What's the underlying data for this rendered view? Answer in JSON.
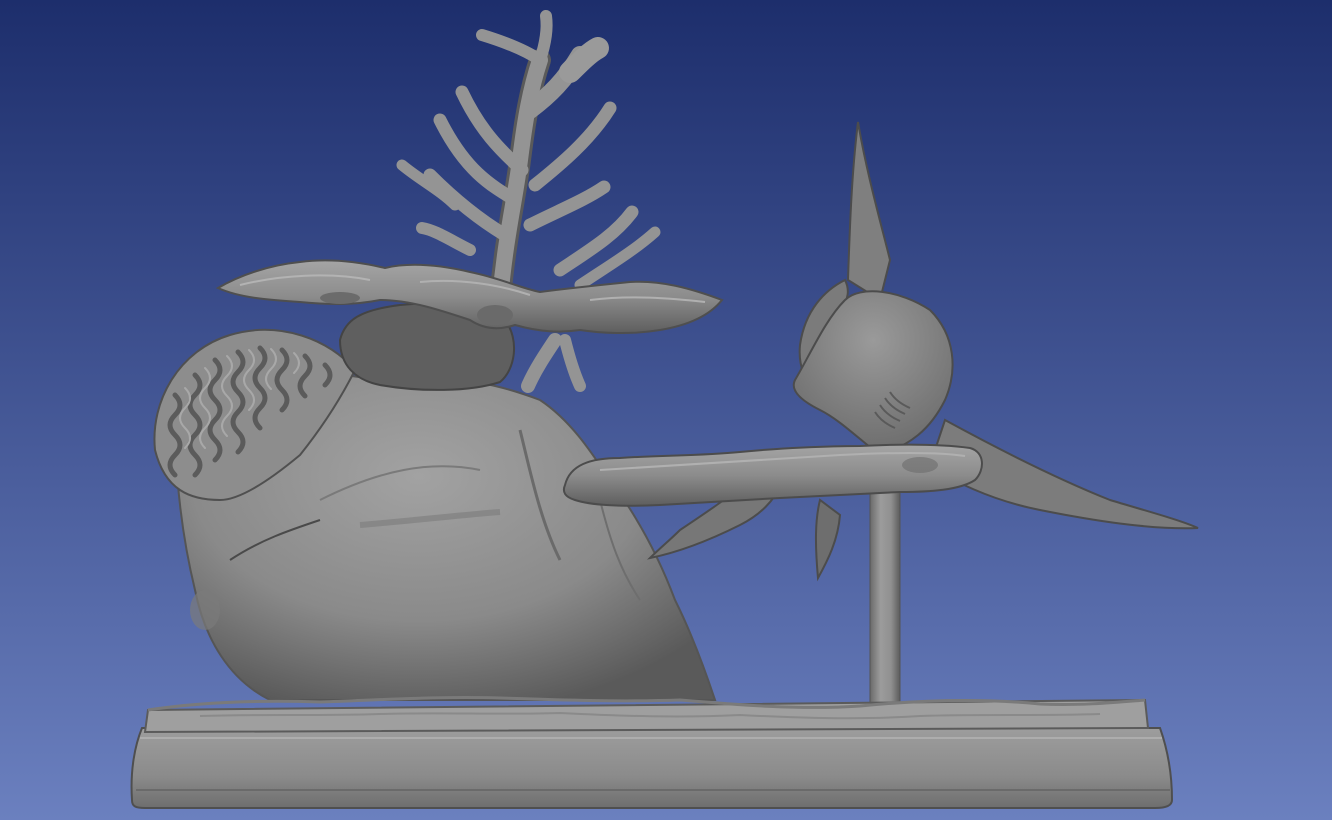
{
  "viewport": {
    "background_top_color": "#1d2e6c",
    "background_bottom_color": "#6b80bf",
    "model_color": "#8a8a8a",
    "model_highlight_color": "#a9a9a9",
    "model_shadow_color": "#4d4d4d"
  },
  "scene": {
    "objects": [
      "coral-rock",
      "brain-coral",
      "table-coral",
      "branching-coral",
      "hammerhead-shark",
      "support-rod",
      "display-base"
    ]
  }
}
